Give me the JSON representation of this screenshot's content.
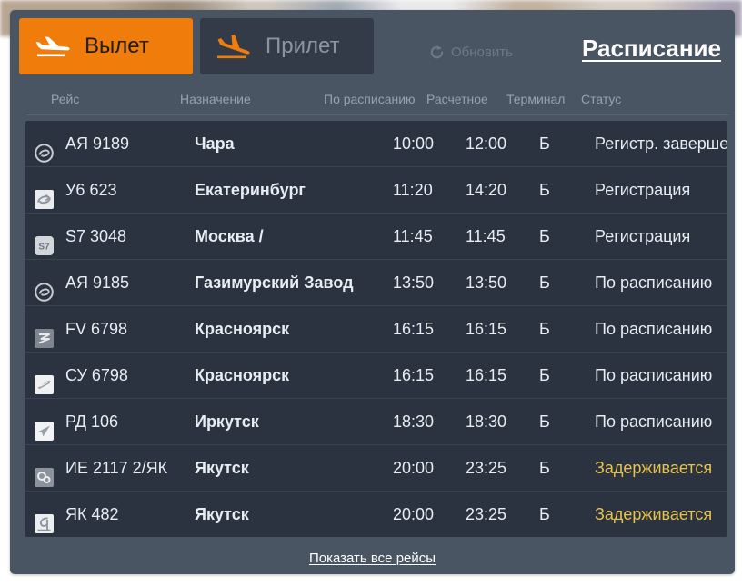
{
  "toolbar": {
    "departure_tab": {
      "label": "Вылет",
      "icon": "plane-departure-icon",
      "active": true
    },
    "arrival_tab": {
      "label": "Прилет",
      "icon": "plane-arrival-icon",
      "active": false
    },
    "refresh": {
      "label": "Обновить",
      "icon": "refresh-icon"
    },
    "schedule_link": "Расписание"
  },
  "columns": {
    "flight": "Рейс",
    "destination": "Назначение",
    "scheduled": "По расписанию",
    "estimated": "Расчетное",
    "terminal": "Терминал",
    "status": "Статус"
  },
  "colors": {
    "accent": "#ef7c0b",
    "panel": "#4a5563",
    "table": "#2b3340",
    "status_delayed": "#e6c24f",
    "text": "#e8edf2",
    "muted": "#98a2ae"
  },
  "rows": [
    {
      "logo": "airline-logo-aya",
      "flight": "АЯ 9189",
      "destination": "Чара",
      "scheduled": "10:00",
      "estimated": "12:00",
      "terminal": "Б",
      "status": "Регистр. завершен",
      "status_state": "normal"
    },
    {
      "logo": "airline-logo-u6",
      "flight": "У6 623",
      "destination": "Екатеринбург",
      "scheduled": "11:20",
      "estimated": "14:20",
      "terminal": "Б",
      "status": "Регистрация",
      "status_state": "normal"
    },
    {
      "logo": "airline-logo-s7",
      "flight": "S7 3048",
      "destination": "Москва /",
      "scheduled": "11:45",
      "estimated": "11:45",
      "terminal": "Б",
      "status": "Регистрация",
      "status_state": "normal"
    },
    {
      "logo": "airline-logo-aya",
      "flight": "АЯ 9185",
      "destination": "Газимурский Завод",
      "scheduled": "13:50",
      "estimated": "13:50",
      "terminal": "Б",
      "status": "По расписанию",
      "status_state": "normal"
    },
    {
      "logo": "airline-logo-fv",
      "flight": "FV 6798",
      "destination": "Красноярск",
      "scheduled": "16:15",
      "estimated": "16:15",
      "terminal": "Б",
      "status": "По расписанию",
      "status_state": "normal"
    },
    {
      "logo": "airline-logo-su",
      "flight": "СУ 6798",
      "destination": "Красноярск",
      "scheduled": "16:15",
      "estimated": "16:15",
      "terminal": "Б",
      "status": "По расписанию",
      "status_state": "normal"
    },
    {
      "logo": "airline-logo-rd",
      "flight": "РД 106",
      "destination": "Иркутск",
      "scheduled": "18:30",
      "estimated": "18:30",
      "terminal": "Б",
      "status": "По расписанию",
      "status_state": "normal"
    },
    {
      "logo": "airline-logo-ie",
      "flight": "ИЕ 2117 2/ЯК",
      "destination": "Якутск",
      "scheduled": "20:00",
      "estimated": "23:25",
      "terminal": "Б",
      "status": "Задерживается",
      "status_state": "delayed"
    },
    {
      "logo": "airline-logo-yak",
      "flight": "ЯК 482",
      "destination": "Якутск",
      "scheduled": "20:00",
      "estimated": "23:25",
      "terminal": "Б",
      "status": "Задерживается",
      "status_state": "delayed"
    }
  ],
  "footer": {
    "show_all_link": "Показать все рейсы"
  }
}
